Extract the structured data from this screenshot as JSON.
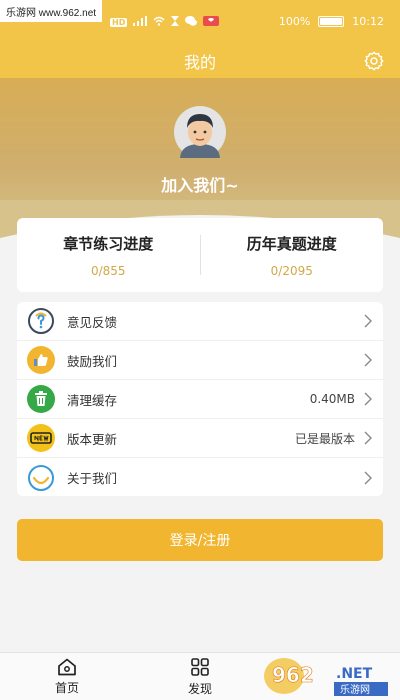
{
  "status_bar": {
    "watermark": "乐游网 www.962.net",
    "hd_badge": "HD",
    "battery": "100%",
    "time": "10:12"
  },
  "header": {
    "title": "我的"
  },
  "profile": {
    "join_text": "加入我们~"
  },
  "progress": [
    {
      "title": "章节练习进度",
      "value": "0/855"
    },
    {
      "title": "历年真题进度",
      "value": "0/2095"
    }
  ],
  "menu": [
    {
      "label": "意见反馈",
      "value": "",
      "icon": "feedback-icon"
    },
    {
      "label": "鼓励我们",
      "value": "",
      "icon": "thumbs-up-icon"
    },
    {
      "label": "清理缓存",
      "value": "0.40MB",
      "icon": "trash-icon"
    },
    {
      "label": "版本更新",
      "value": "已是最版本",
      "icon": "new-badge-icon"
    },
    {
      "label": "关于我们",
      "value": "",
      "icon": "smile-icon"
    }
  ],
  "login_button": "登录/注册",
  "tabs": [
    {
      "label": "首页",
      "icon": "home-icon"
    },
    {
      "label": "发现",
      "icon": "grid-icon"
    }
  ],
  "logo": {
    "number": "962",
    "suffix": ".NET",
    "tagline": "乐游网"
  },
  "colors": {
    "primary": "#f2c447",
    "accent": "#f2b52f",
    "progress_value": "#d2a84a"
  }
}
